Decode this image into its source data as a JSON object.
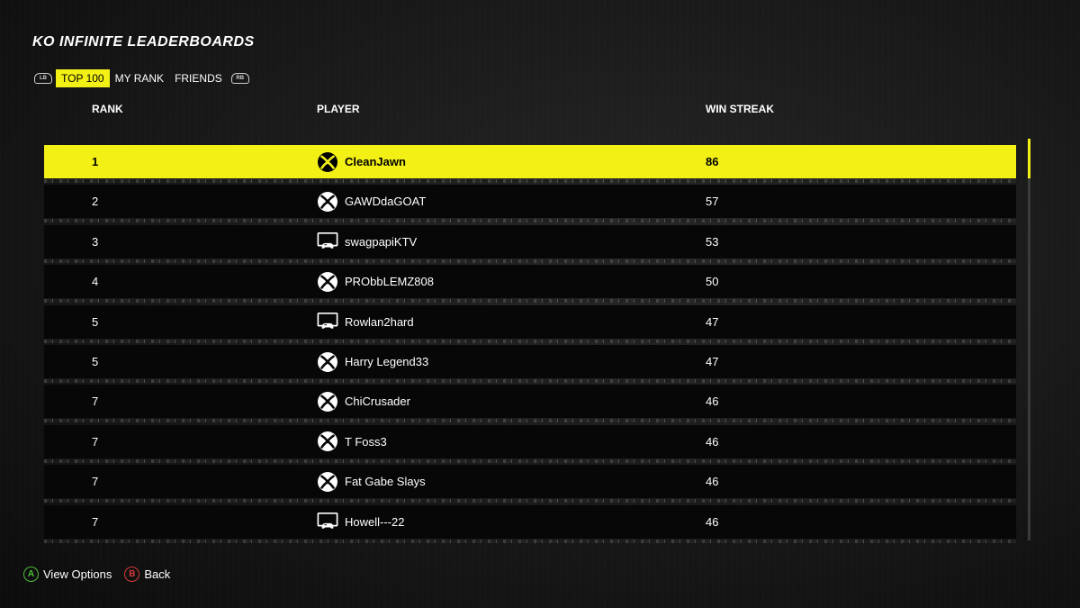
{
  "header": {
    "title": "KO INFINITE LEADERBOARDS",
    "left_bumper": "LB",
    "right_bumper": "RB",
    "tabs": [
      {
        "label": "TOP 100",
        "active": true
      },
      {
        "label": "MY RANK",
        "active": false
      },
      {
        "label": "FRIENDS",
        "active": false
      }
    ]
  },
  "columns": {
    "rank": "RANK",
    "player": "PLAYER",
    "streak": "WIN STREAK"
  },
  "rows": [
    {
      "rank": "1",
      "platform": "xbox-icon",
      "player": "CleanJawn",
      "streak": "86",
      "selected": true
    },
    {
      "rank": "2",
      "platform": "xbox-icon",
      "player": "GAWDdaGOAT",
      "streak": "57"
    },
    {
      "rank": "3",
      "platform": "pc-icon",
      "player": "swagpapiKTV",
      "streak": "53"
    },
    {
      "rank": "4",
      "platform": "xbox-icon",
      "player": "PRObbLEMZ808",
      "streak": "50"
    },
    {
      "rank": "5",
      "platform": "pc-icon",
      "player": "Rowlan2hard",
      "streak": "47"
    },
    {
      "rank": "5",
      "platform": "xbox-icon",
      "player": "Harry Legend33",
      "streak": "47"
    },
    {
      "rank": "7",
      "platform": "xbox-icon",
      "player": "ChiCrusader",
      "streak": "46"
    },
    {
      "rank": "7",
      "platform": "xbox-icon",
      "player": "T Foss3",
      "streak": "46"
    },
    {
      "rank": "7",
      "platform": "xbox-icon",
      "player": "Fat Gabe Slays",
      "streak": "46"
    },
    {
      "rank": "7",
      "platform": "pc-icon",
      "player": "Howell---22",
      "streak": "46"
    }
  ],
  "footer": {
    "a_glyph": "A",
    "a_label": "View Options",
    "b_glyph": "B",
    "b_label": "Back"
  },
  "colors": {
    "accent": "#f3f016",
    "row_bg": "#070707",
    "button_a": "#4fbf3b",
    "button_b": "#d83a3a"
  }
}
